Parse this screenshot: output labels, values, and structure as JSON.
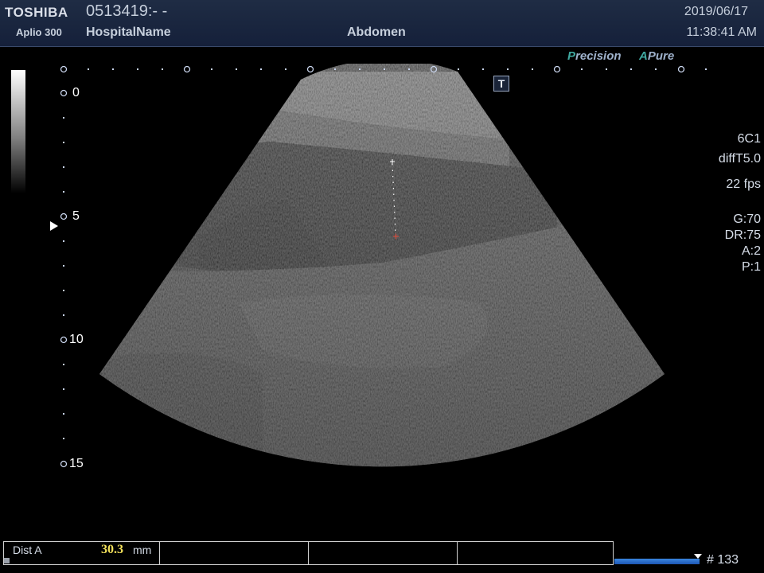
{
  "header": {
    "brand": "TOSHIBA",
    "model": "Aplio 300",
    "patient_id": "0513419:- -",
    "hospital": "HospitalName",
    "exam": "Abdomen",
    "date": "2019/06/17",
    "time": "11:38:41 AM"
  },
  "overlay": {
    "precision_p": "P",
    "precision_rest": "recision",
    "apure_a": "A",
    "apure_rest": "Pure",
    "t_marker": "T"
  },
  "params": {
    "probe": "6C1",
    "mode": "diffT5.0",
    "fps": "22 fps",
    "gain": "G:70",
    "dr": "DR:75",
    "a": "A:2",
    "p": "P:1"
  },
  "depth_scale": {
    "labels": [
      "0",
      "5",
      "10",
      "15"
    ]
  },
  "measurement": {
    "label": "Dist A",
    "value": "30.3",
    "unit": "mm"
  },
  "cine": {
    "frame": "# 133"
  }
}
